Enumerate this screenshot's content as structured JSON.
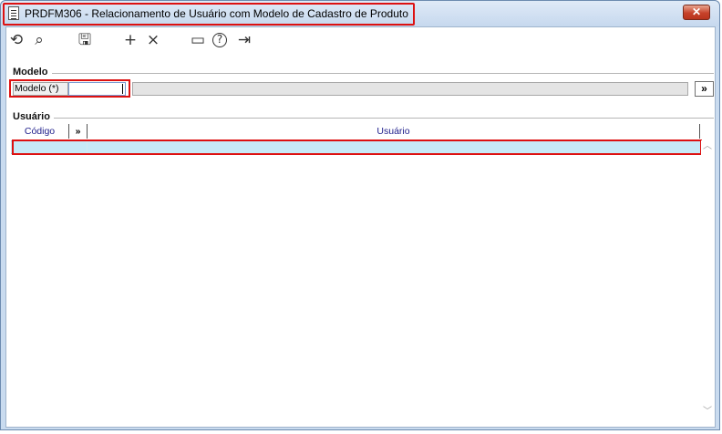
{
  "window": {
    "title": "PRDFM306 - Relacionamento de Usuário com Modelo de Cadastro de Produto",
    "close_label": "✕"
  },
  "toolbar": {
    "buttons": [
      {
        "icon": "undo-icon",
        "glyph": "⟲"
      },
      {
        "icon": "search-icon",
        "glyph": "⌕"
      },
      {
        "icon": "save-icon",
        "glyph": "🖫"
      },
      {
        "icon": "add-icon",
        "glyph": "+"
      },
      {
        "icon": "delete-icon",
        "glyph": "×"
      },
      {
        "icon": "calendar-icon",
        "glyph": "▭"
      },
      {
        "icon": "help-icon",
        "glyph": "?"
      },
      {
        "icon": "exit-icon",
        "glyph": "⇥"
      }
    ]
  },
  "modelo_group": {
    "label": "Modelo",
    "field_label": "Modelo (*)",
    "field_value": "",
    "description_value": "",
    "lookup_label": "»"
  },
  "usuario_group": {
    "label": "Usuário",
    "columns": [
      "Código",
      "»",
      "Usuário"
    ],
    "rows": [
      {
        "codigo": "",
        "usuario": ""
      }
    ]
  },
  "colors": {
    "highlight": "#dd1111",
    "selected_row": "#c7eaf7",
    "header_text": "#20208c"
  }
}
